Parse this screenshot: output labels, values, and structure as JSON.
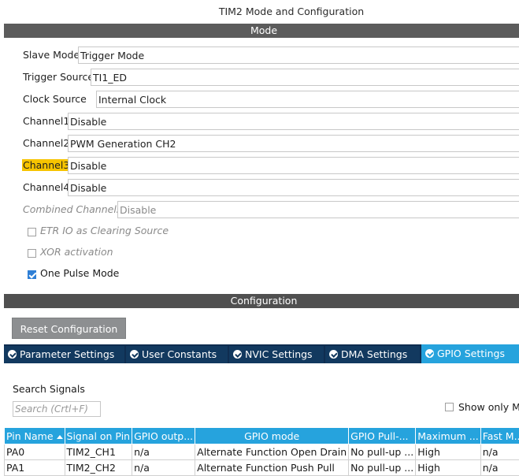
{
  "window": {
    "title": "TIM2 Mode and Configuration"
  },
  "mode_section": {
    "header": "Mode",
    "fields": [
      {
        "label": "Slave Mode",
        "value": "Trigger Mode"
      },
      {
        "label": "Trigger Source",
        "value": "TI1_ED"
      },
      {
        "label": "Clock Source",
        "value": "Internal Clock"
      },
      {
        "label": "Channel1",
        "value": "Disable"
      },
      {
        "label": "Channel2",
        "value": "PWM Generation CH2"
      },
      {
        "label": "Channel3",
        "value": "Disable"
      },
      {
        "label": "Channel4",
        "value": "Disable"
      },
      {
        "label": "Combined Channels",
        "value": "Disable"
      }
    ],
    "checkboxes": [
      {
        "label": "ETR IO as Clearing Source",
        "checked": false,
        "enabled": false
      },
      {
        "label": "XOR activation",
        "checked": false,
        "enabled": false
      },
      {
        "label": "One Pulse Mode",
        "checked": true,
        "enabled": true
      }
    ]
  },
  "config_section": {
    "header": "Configuration",
    "reset_label": "Reset Configuration",
    "tabs": [
      {
        "label": "Parameter Settings",
        "active": false
      },
      {
        "label": "User Constants",
        "active": false
      },
      {
        "label": "NVIC Settings",
        "active": false
      },
      {
        "label": "DMA Settings",
        "active": false
      },
      {
        "label": "GPIO Settings",
        "active": true
      }
    ],
    "search_label": "Search Signals",
    "search_placeholder": "Search (Crtl+F)",
    "show_only_label": "Show only Mo",
    "table": {
      "columns": [
        "Pin Name",
        "Signal on Pin",
        "GPIO outp...",
        "GPIO mode",
        "GPIO Pull-...",
        "Maximum ...",
        "Fast M..."
      ],
      "rows": [
        [
          "PA0",
          "TIM2_CH1",
          "n/a",
          "Alternate Function Open Drain",
          "No pull-up ...",
          "High",
          "n/a"
        ],
        [
          "PA1",
          "TIM2_CH2",
          "n/a",
          "Alternate Function Push Pull",
          "No pull-up ...",
          "High",
          "n/a"
        ]
      ]
    }
  },
  "colors": {
    "highlight": "#f7c400",
    "tab_active": "#26a3dd",
    "tab_inactive": "#12395f",
    "checkbox_checked": "#2f7fd6"
  }
}
